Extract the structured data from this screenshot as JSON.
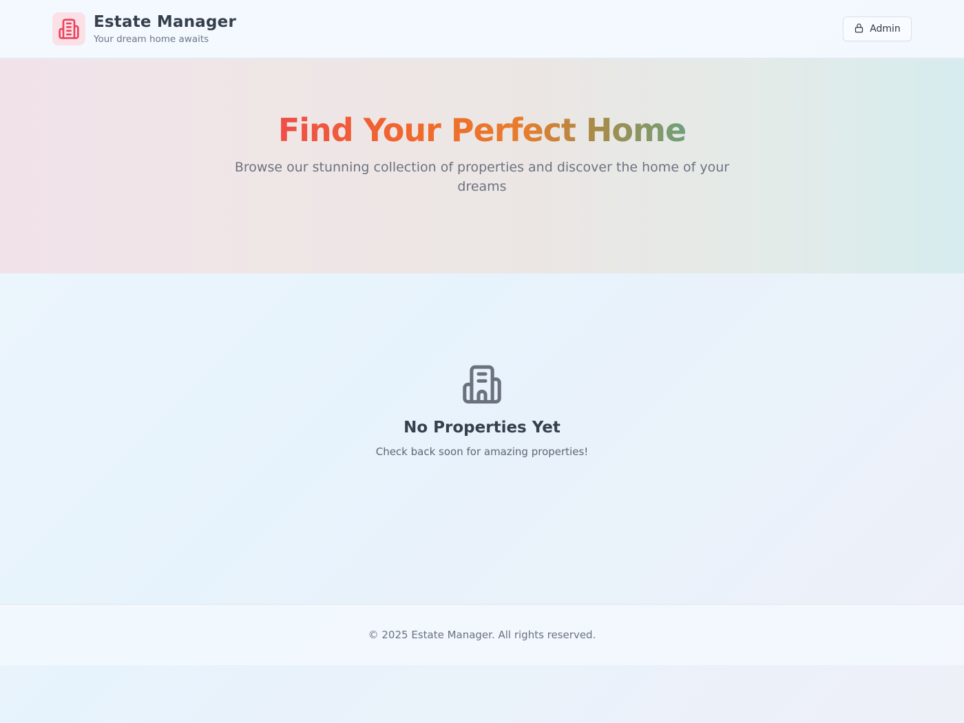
{
  "header": {
    "title": "Estate Manager",
    "subtitle": "Your dream home awaits",
    "logo_icon": "building-icon",
    "admin_button_label": "Admin",
    "admin_button_icon": "lock-icon"
  },
  "hero": {
    "title": "Find Your Perfect Home",
    "subtitle": "Browse our stunning collection of properties and discover the home of your dreams"
  },
  "empty_state": {
    "icon": "building-icon",
    "title": "No Properties Yet",
    "message": "Check back soon for amazing properties!"
  },
  "footer": {
    "text": "© 2025 Estate Manager. All rights reserved."
  },
  "colors": {
    "brand_accent": "#e9435e",
    "title_gradient_start": "#ee4e49",
    "title_gradient_mid": "#f16a2a",
    "title_gradient_end": "#6fa07a",
    "text_dark": "#36404c",
    "text_muted": "#6b7280"
  }
}
